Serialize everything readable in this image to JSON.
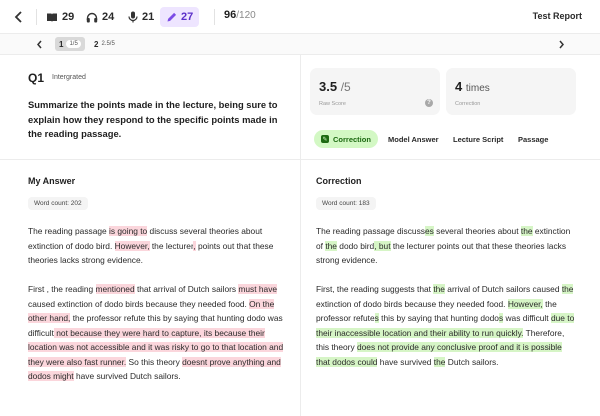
{
  "topbar": {
    "stats": [
      {
        "icon": "book-icon",
        "value": "29"
      },
      {
        "icon": "headphones-icon",
        "value": "24"
      },
      {
        "icon": "microphone-icon",
        "value": "21"
      },
      {
        "icon": "pencil-icon",
        "value": "27",
        "active": true
      }
    ],
    "score": "96",
    "score_total": "/120",
    "test_report_label": "Test Report"
  },
  "pager": {
    "pages": [
      {
        "number": "1",
        "sub": "1/5",
        "active": true
      },
      {
        "number": "2",
        "sub": "2.5/5",
        "active": false
      }
    ]
  },
  "question": {
    "label": "Q1",
    "type": "Intergrated",
    "prompt": "Summarize the points made in the lecture, being sure to explain how they respond to the specific points made in the reading passage."
  },
  "cards": {
    "raw_score": {
      "value": "3.5",
      "unit": "/5",
      "caption": "Raw Score"
    },
    "correction": {
      "value": "4",
      "unit": "times",
      "caption": "Correction"
    }
  },
  "tabs": [
    "Correction",
    "Model Answer",
    "Lecture Script",
    "Passage"
  ],
  "my_answer": {
    "title": "My Answer",
    "word_count": "Word count: 202",
    "paragraphs": [
      [
        {
          "t": "The reading passage "
        },
        {
          "t": "is going to",
          "h": "r"
        },
        {
          "t": " discuss several theories about extinction of dodo bird. "
        },
        {
          "t": "However,",
          "h": "r"
        },
        {
          "t": " the lecturer"
        },
        {
          "t": ",",
          "h": "r"
        },
        {
          "t": " points out that these theories lacks strong evidence."
        }
      ],
      [
        {
          "t": "First , the reading "
        },
        {
          "t": "mentioned",
          "h": "r"
        },
        {
          "t": " that arrival of Dutch sailors "
        },
        {
          "t": "must have",
          "h": "r"
        },
        {
          "t": " caused extinction of dodo birds because they needed food. "
        },
        {
          "t": "On the other hand,",
          "h": "r"
        },
        {
          "t": " the professor refute this by saying that hunting dodo was difficult"
        },
        {
          "t": " not because they were hard to capture, its because their location was not accessible and it was risky to go to that location and they were also fast runner.",
          "h": "r"
        },
        {
          "t": " So this theory "
        },
        {
          "t": "doesnt prove anything and dodos might",
          "h": "r"
        },
        {
          "t": " have survived Dutch sailors."
        }
      ]
    ]
  },
  "correction": {
    "title": "Correction",
    "word_count": "Word count: 183",
    "paragraphs": [
      [
        {
          "t": "The reading passage discuss"
        },
        {
          "t": "es",
          "h": "g"
        },
        {
          "t": " several theories about "
        },
        {
          "t": "the",
          "h": "g"
        },
        {
          "t": " extinction of "
        },
        {
          "t": "the",
          "h": "g"
        },
        {
          "t": " dodo bird"
        },
        {
          "t": ", but",
          "h": "g"
        },
        {
          "t": " the lecturer points out that these theories lacks strong evidence."
        }
      ],
      [
        {
          "t": "First, the reading suggests that "
        },
        {
          "t": "the",
          "h": "g"
        },
        {
          "t": " arrival of Dutch sailors caused "
        },
        {
          "t": "the",
          "h": "g"
        },
        {
          "t": " extinction of dodo birds because they needed food. "
        },
        {
          "t": "However,",
          "h": "g"
        },
        {
          "t": " the professor refute"
        },
        {
          "t": "s",
          "h": "g"
        },
        {
          "t": " this by saying that hunting dodo"
        },
        {
          "t": "s",
          "h": "g"
        },
        {
          "t": " was difficult "
        },
        {
          "t": "due to their inaccessible location and their ability to run quickly.",
          "h": "g"
        },
        {
          "t": " Therefore, this theory "
        },
        {
          "t": "does not provide any conclusive proof and it is possible that dodos could",
          "h": "g"
        },
        {
          "t": " have survived "
        },
        {
          "t": "the",
          "h": "g"
        },
        {
          "t": " Dutch sailors."
        }
      ]
    ]
  },
  "colors": {
    "accent_purple": "#5b2fc9",
    "active_stat_bg": "#eee5ff",
    "tab_active_bg": "#d3f8c4",
    "error_highlight": "#fbd6dc",
    "fix_highlight": "#d6f5c6"
  }
}
